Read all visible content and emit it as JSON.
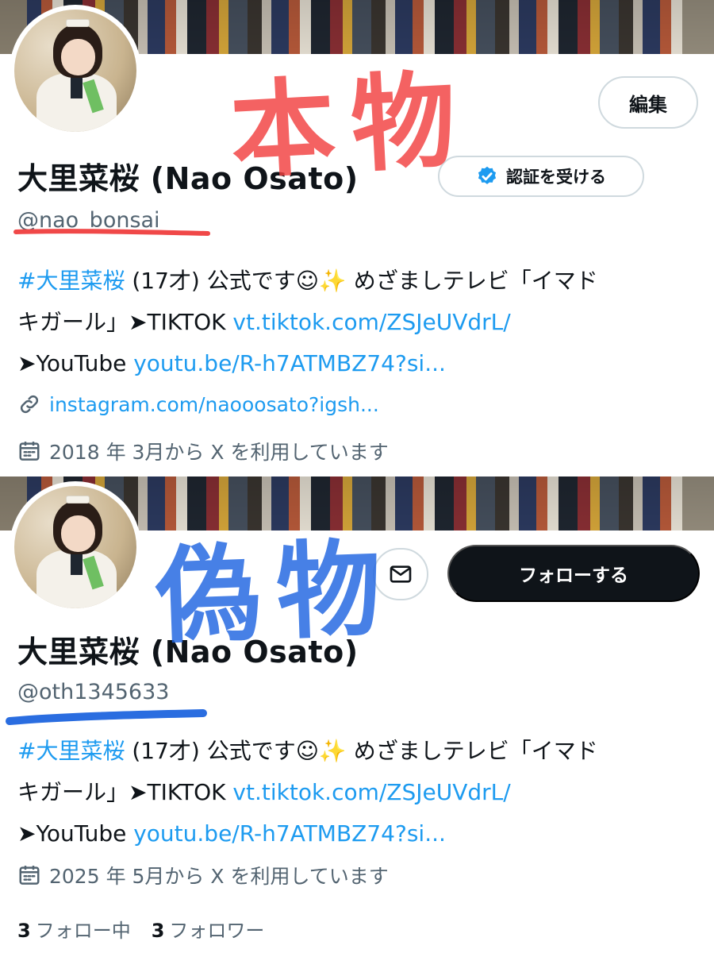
{
  "top": {
    "edit_label": "編集",
    "display_name": "大里菜桜 (Nao Osato)",
    "verify_label": "認証を受ける",
    "handle": "@nao_bonsai",
    "bio": {
      "line1_hashtag": "#大里菜桜",
      "line1_rest": " (17才) 公式です☺✨ めざましテレビ「イマド",
      "line2_text": "キガール」➤TIKTOK ",
      "line2_link": "vt.tiktok.com/ZSJeUVdrL/",
      "line3_text": "➤YouTube ",
      "line3_link": "youtu.be/R-h7ATMBZ74?si..."
    },
    "website": "instagram.com/naooosato?igsh...",
    "joined": "2018 年 3月から X を利用しています"
  },
  "bottom": {
    "follow_label": "フォローする",
    "display_name": "大里菜桜 (Nao Osato)",
    "handle": "@oth1345633",
    "bio": {
      "line1_hashtag": "#大里菜桜",
      "line1_rest": " (17才) 公式です☺✨ めざましテレビ「イマド",
      "line2_text": "キガール」➤TIKTOK ",
      "line2_link": "vt.tiktok.com/ZSJeUVdrL/",
      "line3_text": "➤YouTube ",
      "line3_link": "youtu.be/R-h7ATMBZ74?si..."
    },
    "joined": "2025 年 5月から X を利用しています",
    "following_count": "3",
    "following_label": "フォロー中",
    "followers_count": "3",
    "followers_label": "フォロワー"
  },
  "annotations": {
    "real_label": "本物",
    "fake_label": "偽物"
  },
  "colors": {
    "link": "#1d9bf0",
    "real_marker": "#f24040",
    "fake_marker": "#1f64e1",
    "follow_button": "#0f1419"
  }
}
